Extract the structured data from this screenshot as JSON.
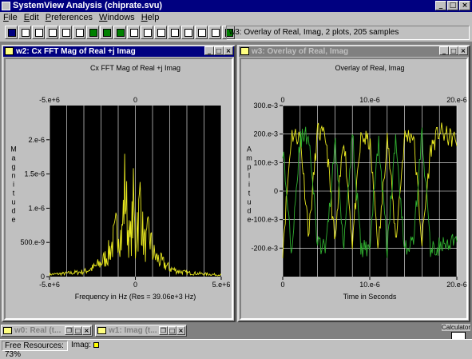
{
  "app": {
    "title": "SystemView Analysis (chiprate.svu)"
  },
  "menu": [
    "File",
    "Edit",
    "Preferences",
    "Windows",
    "Help"
  ],
  "toolbar": {
    "status": "w3: Overlay of Real, Imag, 2 plots, 205 samples"
  },
  "windows": {
    "w2": {
      "title": "w2: Cx FFT Mag of Real +j Imag",
      "chart_title": "Cx FFT Mag of Real +j Imag",
      "xlabel": "Frequency in Hz (Res = 39.06e+3 Hz)",
      "ylabel": "Magnitude",
      "top_ticks": [
        "-5.e+6",
        "0"
      ],
      "bottom_ticks": [
        "-5.e+6",
        "0",
        "5.e+6"
      ],
      "y_ticks": [
        "2.e-6",
        "1.5e-6",
        "1.e-6",
        "500.e-9",
        "0"
      ]
    },
    "w3": {
      "title": "w3: Overlay of Real, Imag",
      "chart_title": "Overlay of Real, Imag",
      "xlabel": "Time in Seconds",
      "ylabel": "Amplitude",
      "top_ticks": [
        "0",
        "10.e-6",
        "20.e-6"
      ],
      "bottom_ticks": [
        "0",
        "10.e-6",
        "20.e-6"
      ],
      "y_ticks": [
        "300.e-3",
        "200.e-3",
        "100.e-3",
        "0",
        "-100.e-3",
        "-200.e-3"
      ]
    }
  },
  "minimized": [
    {
      "title": "w0: Real (t..."
    },
    {
      "title": "w1: Imag (t..."
    }
  ],
  "calculator_label": "Calculator",
  "statusbar": {
    "resources": "Free Resources: 73%",
    "imag_label": "Imag:"
  },
  "colors": {
    "trace_yellow": "#e8e820",
    "trace_green": "#30b030",
    "plot_bg": "#000000"
  },
  "chart_data": [
    {
      "type": "line",
      "title": "Cx FFT Mag of Real +j Imag",
      "xlabel": "Frequency in Hz (Res = 39.06e+3 Hz)",
      "ylabel": "Magnitude",
      "xlim": [
        -5000000,
        5000000
      ],
      "ylim": [
        0,
        2500000000
      ],
      "y_unit_scale": "e-15",
      "series": [
        {
          "x": [
            -5000000,
            -4000000,
            -3000000,
            -2500000,
            -2000000,
            -1600000,
            -1200000,
            -1000000,
            -800000,
            -600000,
            -450000,
            -300000,
            -150000,
            -100000,
            0,
            100000,
            150000,
            300000,
            450000,
            600000,
            800000,
            1000000,
            1200000,
            1600000,
            2000000,
            2500000,
            3000000,
            4000000,
            5000000
          ],
          "values": [
            40000000,
            60000000,
            90000000,
            150000000,
            250000000,
            400000000,
            700000000,
            1000000000,
            650000000,
            1700000000,
            900000000,
            600000000,
            1100000000,
            1400000000,
            450000000,
            1200000000,
            900000000,
            1500000000,
            700000000,
            550000000,
            800000000,
            450000000,
            350000000,
            250000000,
            150000000,
            100000000,
            70000000,
            50000000,
            30000000
          ]
        }
      ]
    },
    {
      "type": "line",
      "title": "Overlay of Real, Imag",
      "xlabel": "Time in Seconds",
      "ylabel": "Amplitude",
      "xlim": [
        0,
        20
      ],
      "x_unit_scale": "e-6",
      "ylim": [
        -300,
        300
      ],
      "y_unit_scale": "e-3",
      "series": [
        {
          "name": "Real",
          "x": [
            0,
            1,
            2,
            3,
            4,
            5,
            6,
            7,
            8,
            9,
            10,
            11,
            12,
            13,
            14,
            15,
            16,
            17,
            18,
            19,
            20
          ],
          "values": [
            -200,
            200,
            190,
            -150,
            210,
            180,
            -190,
            200,
            -180,
            190,
            170,
            -200,
            200,
            -170,
            190,
            200,
            -180,
            150,
            210,
            190,
            180
          ]
        },
        {
          "name": "Imag",
          "x": [
            0,
            1,
            2,
            3,
            4,
            5,
            6,
            7,
            8,
            9,
            10,
            11,
            12,
            13,
            14,
            15,
            16,
            17,
            18,
            19,
            20
          ],
          "values": [
            150,
            -200,
            180,
            200,
            -190,
            -200,
            170,
            -180,
            200,
            -210,
            -190,
            180,
            -200,
            190,
            -200,
            -180,
            200,
            -210,
            -190,
            -200,
            -170
          ]
        }
      ]
    }
  ]
}
